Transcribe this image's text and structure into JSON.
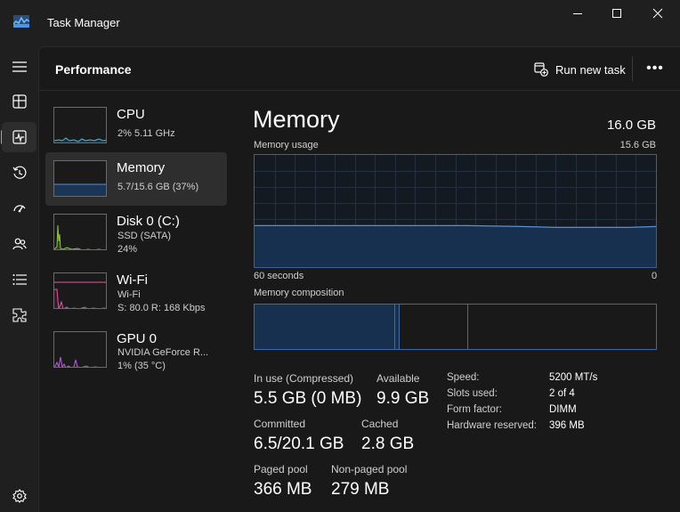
{
  "window": {
    "title": "Task Manager"
  },
  "header": {
    "page_title": "Performance",
    "run_task_label": "Run new task",
    "more_label": "•••"
  },
  "rail": {
    "items": [
      "hamburger-icon",
      "processes-icon",
      "performance-icon",
      "app-history-icon",
      "startup-apps-icon",
      "users-icon",
      "details-icon",
      "services-icon",
      "settings-icon"
    ],
    "active": "performance-icon"
  },
  "devices": [
    {
      "name": "CPU",
      "line1": "2%  5.11 GHz",
      "line2": "",
      "color": "#4fb7e0"
    },
    {
      "name": "Memory",
      "line1": "5.7/15.6 GB (37%)",
      "line2": "",
      "color": "#5b8fd8"
    },
    {
      "name": "Disk 0 (C:)",
      "line1": "SSD (SATA)",
      "line2": "24%",
      "color": "#8dc63f"
    },
    {
      "name": "Wi-Fi",
      "line1": "Wi-Fi",
      "line2": "S: 80.0  R: 168 Kbps",
      "color": "#e25a9a"
    },
    {
      "name": "GPU 0",
      "line1": "NVIDIA GeForce R...",
      "line2": "1% (35 °C)",
      "color": "#b45fd8"
    }
  ],
  "memory": {
    "title": "Memory",
    "total": "16.0 GB",
    "usage_label": "Memory usage",
    "usage_max": "15.6 GB",
    "axis_left": "60 seconds",
    "axis_right": "0",
    "usage_fraction": 0.37,
    "composition_label": "Memory composition",
    "composition": {
      "in_use": 0.35,
      "modified": 0.01,
      "standby": 0.17,
      "free": 0.47
    },
    "stats": {
      "in_use_label": "In use (Compressed)",
      "in_use_value": "5.5 GB (0 MB)",
      "available_label": "Available",
      "available_value": "9.9 GB",
      "committed_label": "Committed",
      "committed_value": "6.5/20.1 GB",
      "cached_label": "Cached",
      "cached_value": "2.8 GB",
      "paged_label": "Paged pool",
      "paged_value": "366 MB",
      "nonpaged_label": "Non-paged pool",
      "nonpaged_value": "279 MB"
    },
    "hardware": {
      "speed_label": "Speed:",
      "speed_value": "5200 MT/s",
      "slots_label": "Slots used:",
      "slots_value": "2 of 4",
      "form_label": "Form factor:",
      "form_value": "DIMM",
      "reserved_label": "Hardware reserved:",
      "reserved_value": "396 MB"
    }
  },
  "colors": {
    "accent": "#4cc2ff",
    "memory_line": "#5b8fd8",
    "memory_fill": "#17304f"
  }
}
